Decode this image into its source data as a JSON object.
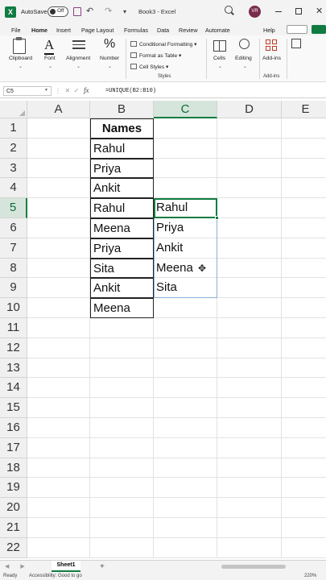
{
  "titlebar": {
    "autosave_label": "AutoSave",
    "autosave_state": "Off",
    "doc_title": "Book3 - Excel",
    "user_initials": "VR",
    "close_glyph": "✕"
  },
  "tabs": [
    "File",
    "Home",
    "Insert",
    "Page Layout",
    "Formulas",
    "Data",
    "Review",
    "Automate",
    "Help"
  ],
  "active_tab": "Home",
  "ribbon": {
    "clipboard": "Clipboard",
    "font": "Font",
    "alignment": "Alignment",
    "number": "Number",
    "conditional_formatting": "Conditional Formatting",
    "format_as_table": "Format as Table",
    "cell_styles": "Cell Styles",
    "styles_group": "Styles",
    "cells": "Cells",
    "editing": "Editing",
    "addins": "Add-ins",
    "addins_group": "Add-ins"
  },
  "formula_bar": {
    "name_box": "C5",
    "fx_label": "fx",
    "formula": "=UNIQUE(B2:B10)"
  },
  "grid": {
    "columns": [
      "A",
      "B",
      "C",
      "D",
      "E"
    ],
    "active_column": "C",
    "active_row": 5,
    "rows": [
      "1",
      "2",
      "3",
      "4",
      "5",
      "6",
      "7",
      "8",
      "9",
      "10",
      "11",
      "12",
      "13",
      "14",
      "15",
      "16",
      "17",
      "18",
      "19",
      "20",
      "21",
      "22"
    ],
    "column_b": [
      "Names",
      "Rahul",
      "Priya",
      "Ankit",
      "Rahul",
      "Meena",
      "Priya",
      "Sita",
      "Ankit",
      "Meena"
    ],
    "column_c_from_row5": [
      "Rahul",
      "Priya",
      "Ankit",
      "Meena",
      "Sita"
    ]
  },
  "sheets": [
    "Sheet1"
  ],
  "status": {
    "ready": "Ready",
    "accessibility": "Accessibility: Good to go",
    "zoom": "220%"
  },
  "colors": {
    "accent": "#107c41",
    "selected_header_bg": "#d6e5dc",
    "spill_border": "#8ab0d6"
  }
}
